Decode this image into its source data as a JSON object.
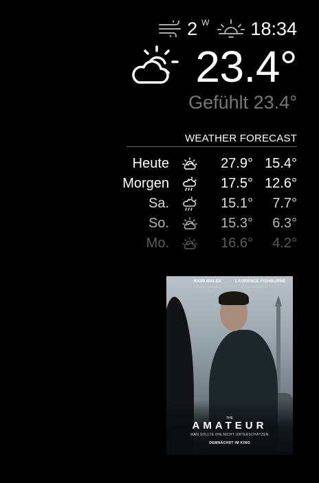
{
  "current": {
    "wind_speed": "2",
    "wind_direction": "W",
    "sun_time": "18:34",
    "temperature": "23.4°",
    "feels_like": "Gefühlt 23.4°",
    "wind_icon": "wind-icon",
    "sun_icon": "sunset-icon",
    "condition_icon": "partly-cloudy-day-icon"
  },
  "forecast": {
    "title": "WEATHER FORECAST",
    "rows": [
      {
        "day": "Heute",
        "icon": "partly-sunny-icon",
        "max": "27.9°",
        "min": "15.4°",
        "opacity": 1.0
      },
      {
        "day": "Morgen",
        "icon": "sun-showers-icon",
        "max": "17.5°",
        "min": "12.6°",
        "opacity": 1.0
      },
      {
        "day": "Sa.",
        "icon": "sun-showers-icon",
        "max": "15.1°",
        "min": "7.7°",
        "opacity": 0.85
      },
      {
        "day": "So.",
        "icon": "partly-sunny-icon",
        "max": "15.3°",
        "min": "6.3°",
        "opacity": 0.7
      },
      {
        "day": "Mo.",
        "icon": "partly-sunny-icon",
        "max": "16.6°",
        "min": "4.2°",
        "opacity": 0.35
      }
    ]
  },
  "poster": {
    "actor_1": "RAMI MALEK",
    "actor_1_sub": "OSCAR® GEWINNER",
    "actor_2": "LAURENCE FISHBURNE",
    "actor_2_sub": "OSCAR® NOMINIERT",
    "the": "THE",
    "title": "AMATEUR",
    "tagline": "MAN SOLLTE IHN NICHT UNTERSCHÄTZEN",
    "release": "DEMNÄCHST IM KINO"
  }
}
